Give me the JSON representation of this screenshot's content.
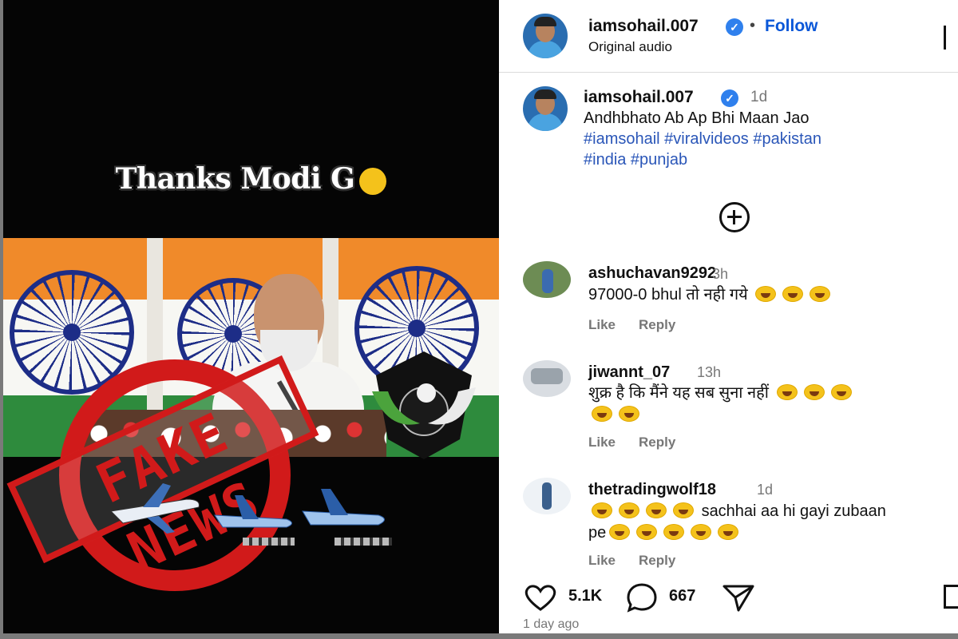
{
  "video": {
    "caption": "Thanks Modi G",
    "stamp_text": "FAKE NEWS"
  },
  "header": {
    "username": "iamsohail.007",
    "separator": "•",
    "follow_label": "Follow",
    "audio_label": "Original audio"
  },
  "post": {
    "username": "iamsohail.007",
    "time": "1d",
    "text_line": "Andhbhato Ab Ap Bhi Maan Jao",
    "tags_line1": "#iamsohail #viralvideos #pakistan",
    "tags_line2": "#india #punjab"
  },
  "comments": [
    {
      "username": "ashuchavan9292",
      "time": "3h",
      "text": "97000-0 bhul तो नही गये",
      "emoji_count": 3,
      "like_label": "Like",
      "reply_label": "Reply"
    },
    {
      "username": "jiwannt_07",
      "time": "13h",
      "text": "शुक्र है कि मैंने यह सब सुना नहीं",
      "emoji_count": 5,
      "like_label": "Like",
      "reply_label": "Reply"
    },
    {
      "username": "thetradingwolf18",
      "time": "1d",
      "text_line1": "sachhai aa hi gayi zubaan",
      "text_line2_prefix": "pe",
      "emoji_count_line1": 4,
      "emoji_count_line2": 5,
      "like_label": "Like",
      "reply_label": "Reply"
    }
  ],
  "actions": {
    "likes": "5.1K",
    "comments": "667",
    "posted_ago": "1 day ago"
  },
  "icons": [
    "laughing-emoji-icon",
    "verified-icon",
    "more-options-icon",
    "add-comment-icon",
    "heart-icon",
    "comment-icon",
    "share-icon",
    "bookmark-icon"
  ],
  "colors": {
    "follow_blue": "#0a57d8",
    "hashtag_blue": "#2a56b8",
    "stamp_red": "#d11a1a"
  }
}
